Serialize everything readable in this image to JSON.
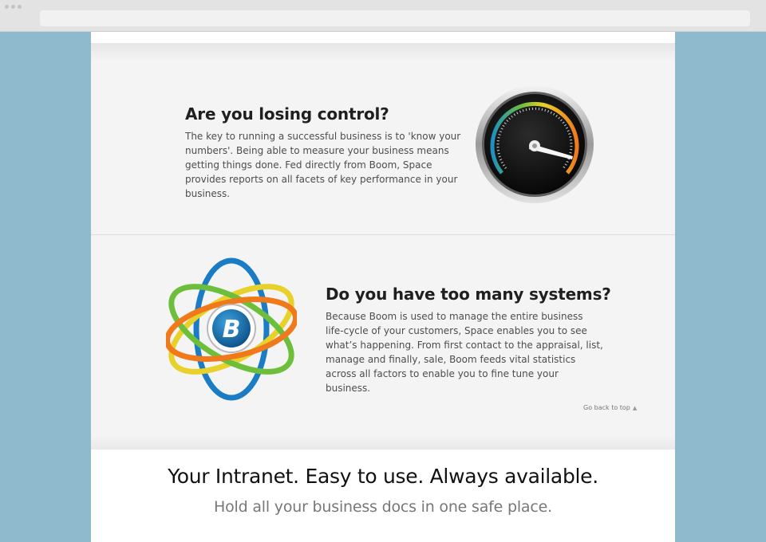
{
  "section_losing_control": {
    "title": "Are you losing control?",
    "body": "The key to running a successful business is to 'know your numbers'. Being able to measure your business means getting things done. Fed directly from Boom, Space provides reports on all facets of key performance in your business."
  },
  "section_too_many_systems": {
    "title": "Do you have too many systems?",
    "body": "Because Boom is used to manage the entire business life-cycle of your customers, Space enables you to see what’s happening. From first contact to the appraisal, list, manage and finally, sale, Boom feeds vital statistics across all factors to enable you to fine tune your business."
  },
  "back_to_top": {
    "label": "Go back to top",
    "icon": "triangle-up-icon"
  },
  "hero": {
    "title": "Your Intranet. Easy to use. Always available.",
    "subtitle": "Hold all your business docs in one safe place."
  },
  "icons": {
    "gauge": "speedometer-gauge-icon",
    "logo": "boom-atom-logo"
  },
  "colors": {
    "background": "#8fb9cc",
    "band": "#f4f4f4",
    "gauge_blue": "#1f8fc0",
    "gauge_green": "#6dbf3b",
    "gauge_yellow": "#e8d12a",
    "gauge_orange": "#f07a1b",
    "logo_blue": "#1a7cc4"
  }
}
